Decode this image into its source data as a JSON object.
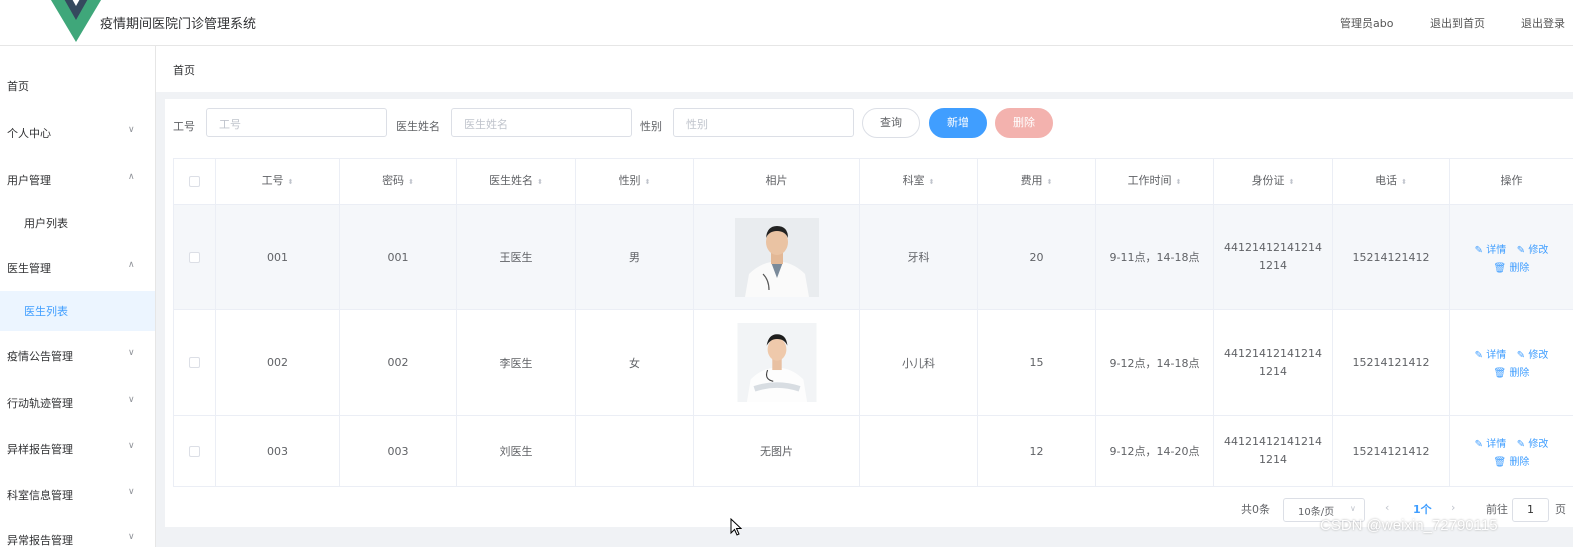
{
  "header": {
    "app_title": "疫情期间医院门诊管理系统",
    "admin_label": "管理员abo",
    "exit_home": "退出到首页",
    "logout": "退出登录"
  },
  "sidebar": {
    "items": [
      {
        "label": "首页",
        "arrow": ""
      },
      {
        "label": "个人中心",
        "arrow": "∨"
      },
      {
        "label": "用户管理",
        "arrow": "∧"
      },
      {
        "label": "用户列表",
        "arrow": ""
      },
      {
        "label": "医生管理",
        "arrow": "∧"
      },
      {
        "label": "医生列表",
        "arrow": ""
      },
      {
        "label": "疫情公告管理",
        "arrow": "∨"
      },
      {
        "label": "行动轨迹管理",
        "arrow": "∨"
      },
      {
        "label": "异样报告管理",
        "arrow": "∨"
      },
      {
        "label": "科室信息管理",
        "arrow": "∨"
      },
      {
        "label": "异常报告管理",
        "arrow": "∨"
      }
    ]
  },
  "breadcrumb": "首页",
  "search": {
    "job_label": "工号",
    "job_placeholder": "工号",
    "name_label": "医生姓名",
    "name_placeholder": "医生姓名",
    "gender_label": "性别",
    "gender_placeholder": "性别",
    "query": "查询",
    "add": "新增",
    "delete": "删除"
  },
  "table": {
    "headers": [
      "工号",
      "密码",
      "医生姓名",
      "性别",
      "相片",
      "科室",
      "费用",
      "工作时间",
      "身份证",
      "电话",
      "操作"
    ],
    "sort_icon": "⬍",
    "rows": [
      {
        "job": "001",
        "pwd": "001",
        "name": "王医生",
        "gender": "男",
        "photo": "",
        "dept": "牙科",
        "fee": "20",
        "time": "9-11点，14-18点",
        "id_a": "44121412141214",
        "id_b": "1214",
        "phone": "15214121412"
      },
      {
        "job": "002",
        "pwd": "002",
        "name": "李医生",
        "gender": "女",
        "photo": "",
        "dept": "小儿科",
        "fee": "15",
        "time": "9-12点，14-18点",
        "id_a": "44121412141214",
        "id_b": "1214",
        "phone": "15214121412"
      },
      {
        "job": "003",
        "pwd": "003",
        "name": "刘医生",
        "gender": "",
        "photo": "无图片",
        "dept": "",
        "fee": "12",
        "time": "9-12点，14-20点",
        "id_a": "44121412141214",
        "id_b": "1214",
        "phone": "15214121412"
      }
    ],
    "ops": {
      "detail": "详情",
      "edit": "修改",
      "delete": "删除"
    }
  },
  "pagination": {
    "total": "共0条",
    "page_size": "10条/页",
    "current": "1个",
    "goto": "前往",
    "goto_value": "1",
    "page_unit": "页"
  },
  "watermark": "CSDN @weixin_72790115",
  "colors": {
    "primary": "#409eff",
    "danger_light": "#f3b2ae",
    "logo_green": "#3fa77a",
    "logo_dark": "#35495e"
  }
}
